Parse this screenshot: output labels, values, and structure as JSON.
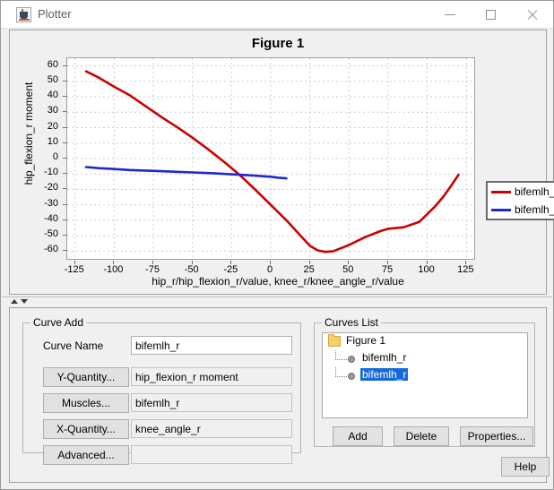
{
  "window": {
    "title": "Plotter",
    "icon": "java-coffee-cup-icon",
    "minimize_label": "—",
    "maximize_label": "☐",
    "close_label": "✕"
  },
  "chart_panel": {
    "title": "Figure 1"
  },
  "chart_data": {
    "type": "line",
    "title": "Figure 1",
    "xlabel": "hip_r/hip_flexion_r/value, knee_r/knee_angle_r/value",
    "ylabel": "hip_flexion_r moment",
    "xlim": [
      -130,
      130
    ],
    "ylim": [
      -65,
      65
    ],
    "xticks": [
      -125,
      -100,
      -75,
      -50,
      -25,
      0,
      25,
      50,
      75,
      100,
      125
    ],
    "yticks": [
      60,
      50,
      40,
      30,
      20,
      10,
      0,
      -10,
      -20,
      -30,
      -40,
      -50,
      -60
    ],
    "grid": true,
    "legend_position": "right-outside",
    "series": [
      {
        "name": "bifemlh_r",
        "color": "#cc0000",
        "x": [
          -118,
          -110,
          -100,
          -90,
          -80,
          -70,
          -60,
          -50,
          -40,
          -30,
          -20,
          -10,
          0,
          10,
          20,
          25,
          30,
          35,
          40,
          50,
          60,
          70,
          75,
          85,
          95,
          100,
          105,
          110,
          115,
          120
        ],
        "y": [
          56.5,
          52.5,
          46.5,
          41.0,
          34.0,
          27.0,
          20.5,
          13.5,
          6.0,
          -2.0,
          -10.5,
          -20.0,
          -30.0,
          -40.0,
          -51.0,
          -56.5,
          -59.5,
          -60.5,
          -60.0,
          -56.0,
          -51.0,
          -47.0,
          -45.5,
          -44.5,
          -41.0,
          -36.0,
          -31.0,
          -25.0,
          -18.0,
          -10.5
        ]
      },
      {
        "name": "bifemlh_r",
        "color": "#1f27d0",
        "x": [
          -118,
          -110,
          -100,
          -90,
          -80,
          -70,
          -60,
          -50,
          -40,
          -30,
          -20,
          -10,
          0,
          5,
          10
        ],
        "y": [
          -5.5,
          -6.2,
          -6.8,
          -7.4,
          -7.8,
          -8.2,
          -8.6,
          -9.0,
          -9.4,
          -9.9,
          -10.5,
          -11.1,
          -11.8,
          -12.4,
          -12.8
        ]
      }
    ],
    "legend": [
      {
        "label": "bifemlh_r",
        "color": "#cc0000"
      },
      {
        "label": "bifemlh_r",
        "color": "#1f27d0"
      }
    ]
  },
  "splitter": {
    "collapse_up_label": "collapse-up-arrow",
    "collapse_down_label": "collapse-down-arrow"
  },
  "curve_add": {
    "group_title": "Curve Add",
    "curve_name_label": "Curve Name",
    "curve_name_value": "bifemlh_r",
    "y_quantity_button": "Y-Quantity...",
    "y_quantity_value": "hip_flexion_r moment",
    "muscles_button": "Muscles...",
    "muscles_value": "bifemlh_r",
    "x_quantity_button": "X-Quantity...",
    "x_quantity_value": "knee_angle_r",
    "advanced_button": "Advanced...",
    "advanced_value": ""
  },
  "curves_list": {
    "group_title": "Curves List",
    "root": "Figure 1",
    "items": [
      {
        "label": "bifemlh_r",
        "selected": false
      },
      {
        "label": "bifemlh_r",
        "selected": true
      }
    ],
    "add_button": "Add",
    "delete_button": "Delete",
    "properties_button": "Properties..."
  },
  "footer": {
    "help_button": "Help"
  }
}
